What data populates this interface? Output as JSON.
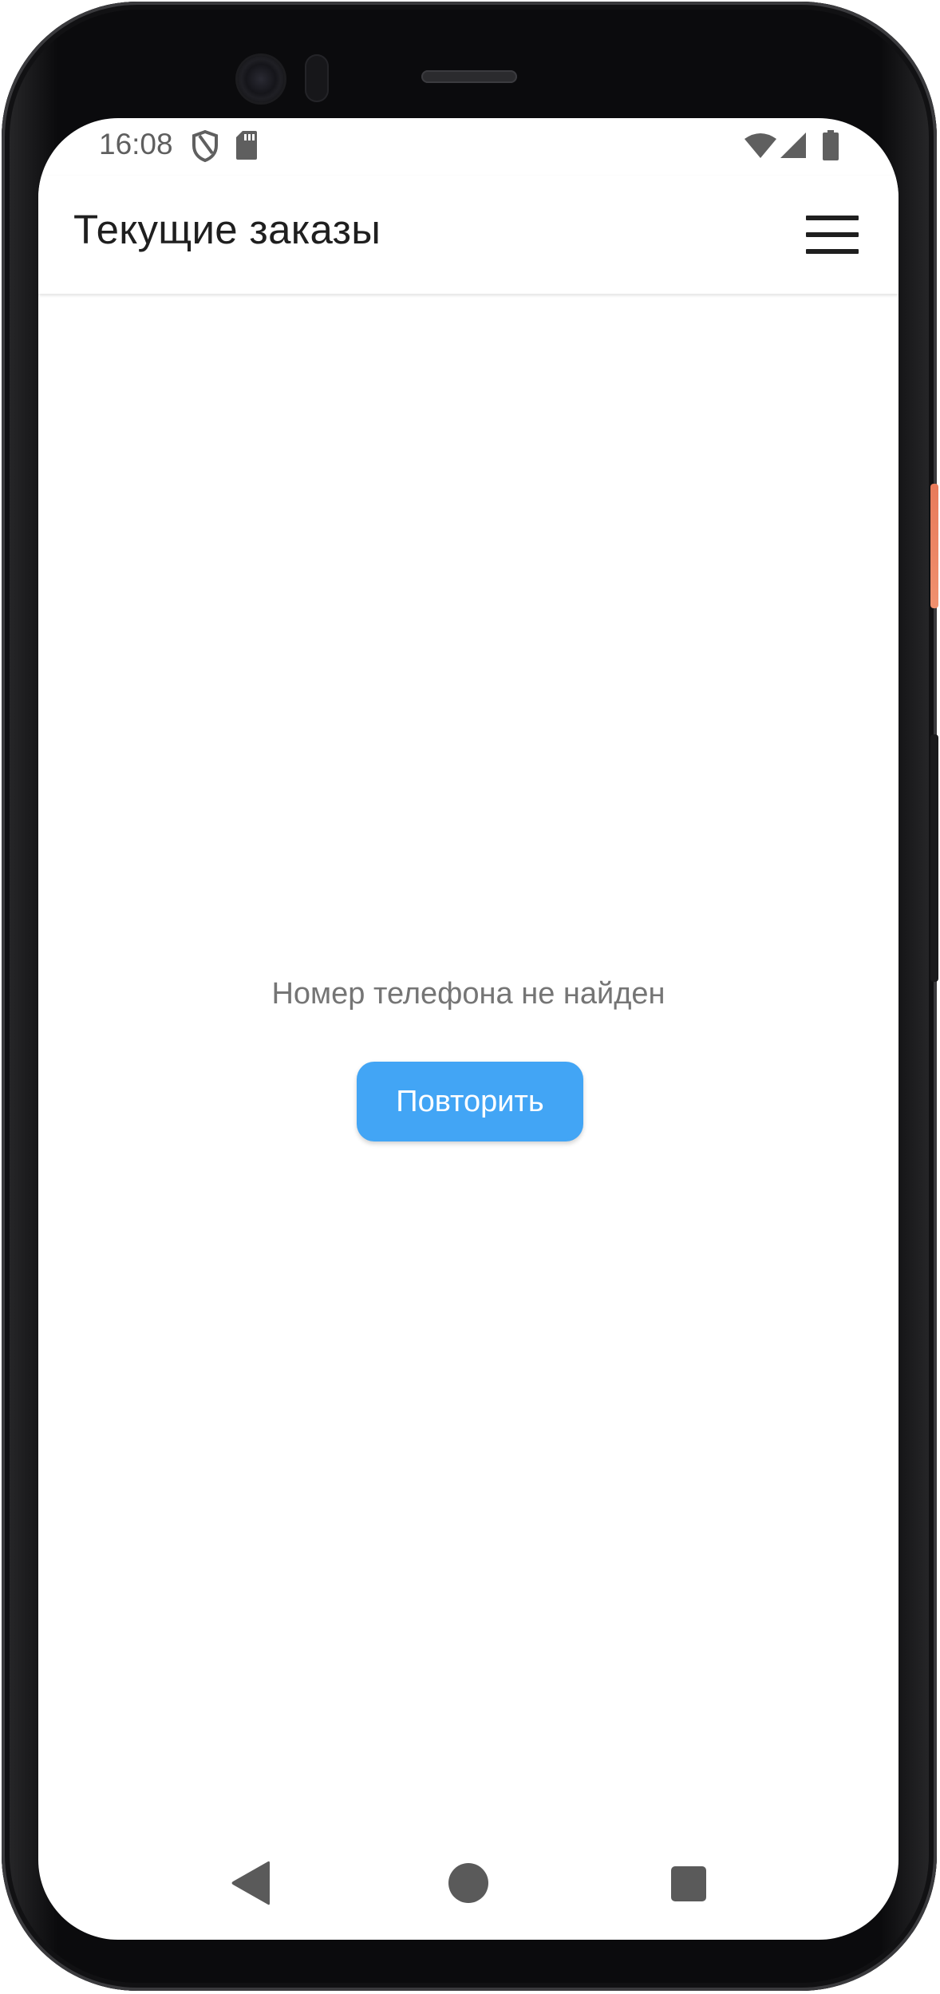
{
  "status_bar": {
    "time": "16:08",
    "icons": [
      "shield-icon",
      "sd-card-icon",
      "wifi-icon",
      "signal-icon",
      "battery-icon"
    ]
  },
  "app_bar": {
    "title": "Текущие заказы",
    "menu_icon": "hamburger-menu-icon"
  },
  "content": {
    "error_message": "Номер телефона не найден",
    "retry_label": "Повторить"
  },
  "nav_bar": {
    "icons": [
      "back-icon",
      "home-icon",
      "recents-icon"
    ]
  },
  "colors": {
    "accent": "#42a5f5",
    "title_text": "#1f1f1f",
    "secondary_text": "#757575",
    "status_icons": "#5f5f5f"
  }
}
